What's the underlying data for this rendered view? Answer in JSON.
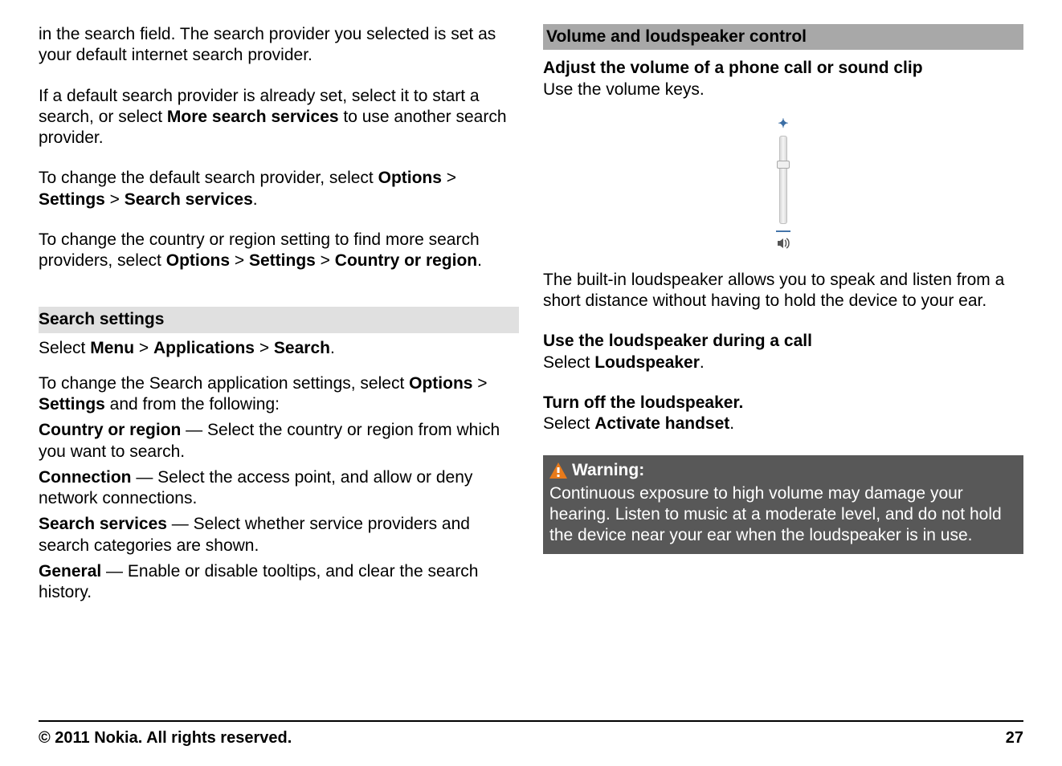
{
  "left": {
    "p1": "in the search field. The search provider you selected is set as your default internet search provider.",
    "p2_a": "If a default search provider is already set, select it to start a search, or select ",
    "p2_b": "More search services",
    "p2_c": " to use another search provider.",
    "p3_a": "To change the default search provider, select ",
    "p3_b": "Options",
    "p3_c": " > ",
    "p3_d": "Settings",
    "p3_e": " > ",
    "p3_f": "Search services",
    "p3_g": ".",
    "p4_a": "To change the country or region setting to find more search providers, select ",
    "p4_b": "Options",
    "p4_c": " > ",
    "p4_d": "Settings",
    "p4_e": " > ",
    "p4_f": "Country or region",
    "p4_g": ".",
    "hdr_settings": "Search settings",
    "ss_a": "Select ",
    "ss_b": "Menu",
    "ss_c": " > ",
    "ss_d": "Applications",
    "ss_e": " > ",
    "ss_f": "Search",
    "ss_g": ".",
    "ss2_a": "To change the Search application settings, select ",
    "ss2_b": "Options",
    "ss2_c": " > ",
    "ss2_d": "Settings",
    "ss2_e": " and from the following:",
    "i1_a": "Country or region",
    "i1_b": "  — Select the country or region from which you want to search.",
    "i2_a": "Connection",
    "i2_b": "  — Select the access point, and allow or deny network connections.",
    "i3_a": "Search services",
    "i3_b": "  — Select whether service providers and search categories are shown.",
    "i4_a": "General",
    "i4_b": "  — Enable or disable tooltips, and clear the search history."
  },
  "right": {
    "hdr_vol": "Volume and loudspeaker control",
    "sub1": "Adjust the volume of a phone call or sound clip",
    "sub1_txt": "Use the volume keys.",
    "loud_p": "The built-in loudspeaker allows you to speak and listen from a short distance without having to hold the device to your ear.",
    "sub2": "Use the loudspeaker during a call",
    "sub2_a": "Select ",
    "sub2_b": "Loudspeaker",
    "sub2_c": ".",
    "sub3": "Turn off the loudspeaker.",
    "sub3_a": "Select ",
    "sub3_b": "Activate handset",
    "sub3_c": ".",
    "warn_title": "Warning:",
    "warn_txt": "Continuous exposure to high volume may damage your hearing. Listen to music at a moderate level, and do not hold the device near your ear when the loudspeaker is in use."
  },
  "footer": {
    "copyright": "© 2011 Nokia. All rights reserved.",
    "page": "27"
  }
}
